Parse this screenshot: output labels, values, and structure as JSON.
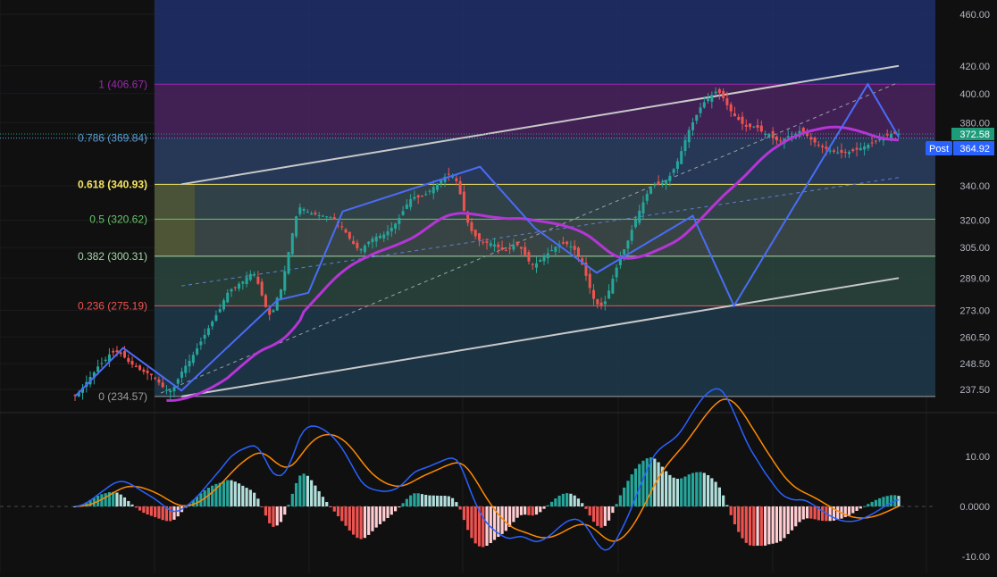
{
  "chart_data": [
    {
      "type": "candlestick",
      "title": "",
      "y_scale": "log",
      "ylim": [
        233,
        470
      ],
      "yticks": [
        "460.00",
        "420.00",
        "400.00",
        "380.00",
        "340.00",
        "320.00",
        "305.00",
        "289.00",
        "273.00",
        "260.50",
        "248.50",
        "237.50"
      ],
      "price_labels": [
        {
          "label": "",
          "value": "372.58",
          "color": "#1e9c7a"
        },
        {
          "label": "Post",
          "value": "364.92",
          "color": "#2962ff"
        }
      ],
      "fib_levels": [
        {
          "label": "1 (406.67)",
          "value": 406.67,
          "color": "#9c27b0"
        },
        {
          "label": "0.786 (369.84)",
          "value": 369.84,
          "color": "#5b9bd5"
        },
        {
          "label": "0.618 (340.93)",
          "value": 340.93,
          "color": "#f5e663"
        },
        {
          "label": "0.5 (320.62)",
          "value": 320.62,
          "color": "#67c36b"
        },
        {
          "label": "0.382 (300.31)",
          "value": 300.31,
          "color": "#a5d6a7"
        },
        {
          "label": "0.236 (275.19)",
          "value": 275.19,
          "color": "#ef5350"
        },
        {
          "label": "0 (234.57)",
          "value": 234.57,
          "color": "#9e9e9e"
        }
      ],
      "colors": {
        "up": "#26a69a",
        "down": "#ef5350",
        "zigzag": "#4a6cf7",
        "moving_average": "#b535d6",
        "channel": "#c8c8c8"
      },
      "x": [
        0,
        1,
        2,
        3,
        4,
        5,
        6,
        7,
        8,
        9,
        10,
        11,
        12,
        13,
        14,
        15,
        16,
        17,
        18,
        19,
        20,
        21,
        22,
        23,
        24,
        25,
        26,
        27,
        28,
        29,
        30,
        31,
        32,
        33,
        34,
        35,
        36,
        37,
        38,
        39,
        40,
        41,
        42,
        43,
        44,
        45,
        46,
        47,
        48,
        49,
        50,
        51,
        52,
        53,
        54,
        55,
        56,
        57,
        58,
        59,
        60,
        61,
        62,
        63,
        64,
        65,
        66,
        67,
        68,
        69,
        70,
        71,
        72,
        73,
        74,
        75,
        76,
        77,
        78,
        79,
        80,
        81,
        82,
        83,
        84,
        85,
        86,
        87,
        88,
        89,
        90,
        91,
        92,
        93,
        94,
        95,
        96,
        97,
        98,
        99,
        100,
        101,
        102,
        103,
        104,
        105,
        106,
        107,
        108,
        109,
        110,
        111,
        112,
        113,
        114,
        115,
        116,
        117,
        118,
        119,
        120,
        121,
        122,
        123,
        124,
        125,
        126,
        127,
        128,
        129,
        130,
        131,
        132,
        133,
        134,
        135,
        136,
        137,
        138,
        139,
        140,
        141,
        142,
        143,
        144,
        145,
        146,
        147,
        148,
        149,
        150,
        151,
        152,
        153,
        154,
        155,
        156,
        157,
        158,
        159,
        160,
        161,
        162,
        163,
        164,
        165,
        166,
        167,
        168,
        169,
        170,
        171,
        172,
        173,
        174,
        175,
        176,
        177,
        178,
        179,
        180,
        181,
        182,
        183,
        184,
        185,
        186,
        187,
        188,
        189,
        190,
        191,
        192,
        193,
        194,
        195,
        196,
        197,
        198,
        199,
        200,
        201,
        202,
        203,
        204,
        205,
        206,
        207,
        208,
        209,
        210,
        211,
        212,
        213,
        214,
        215,
        216,
        217,
        218,
        219
      ],
      "close": [
        235,
        236.2,
        238.2,
        240.6,
        242.8,
        244.8,
        247.3,
        248.8,
        250.3,
        252.6,
        253.5,
        253.7,
        252.8,
        251.2,
        249.3,
        248.1,
        247,
        245.8,
        245,
        244.4,
        243.5,
        242.2,
        240.4,
        238.5,
        237.3,
        237,
        238.5,
        241.8,
        245.1,
        247.6,
        249.8,
        252.4,
        255.3,
        258.4,
        261.5,
        264.6,
        267.7,
        270.7,
        273.6,
        277.9,
        281.6,
        283.4,
        284.4,
        286.1,
        287.2,
        289.4,
        291.1,
        291,
        286.1,
        280.3,
        274.6,
        270.9,
        273.1,
        279.1,
        283.3,
        292.5,
        302.6,
        312.7,
        322.2,
        327.3,
        326.4,
        324.8,
        323.9,
        323.3,
        322.8,
        322.5,
        322.2,
        321.7,
        320.4,
        318.4,
        316.1,
        313.1,
        309.8,
        306.9,
        304.6,
        304.2,
        306,
        308.1,
        309.8,
        310.9,
        311.4,
        312.1,
        313.8,
        315.8,
        318.1,
        321.3,
        325.2,
        329,
        332.1,
        333.4,
        333.1,
        333.6,
        335.1,
        337,
        339.4,
        341.3,
        343.3,
        345.5,
        346.8,
        346,
        342.8,
        335,
        325.3,
        318.6,
        313.9,
        311.1,
        309.1,
        307.8,
        307.5,
        307.3,
        306.6,
        305.2,
        303.7,
        303.3,
        304.2,
        306.2,
        306.2,
        304.3,
        300.9,
        297.6,
        296.1,
        296.6,
        298.4,
        300.3,
        301.9,
        303.6,
        305.4,
        306.7,
        307.1,
        306.8,
        305.6,
        303.7,
        300.5,
        295.9,
        290.1,
        284,
        278.6,
        275.9,
        275.1,
        277.4,
        282.7,
        288.6,
        294.4,
        299.6,
        304,
        308.7,
        314.6,
        320.4,
        325.4,
        330.3,
        335.2,
        339.1,
        340.8,
        340.9,
        341.7,
        343.5,
        346.1,
        350.1,
        355.1,
        361.5,
        368.6,
        375.2,
        380.2,
        385.3,
        390.3,
        394,
        396.6,
        399.1,
        401.4,
        400.4,
        396.8,
        391.9,
        387.7,
        384.3,
        381.9,
        379.2,
        377.3,
        377.1,
        377.5,
        376.6,
        374.2,
        372.6,
        372.6,
        369.9,
        368.4,
        368,
        369.4,
        371,
        371.3,
        372.6,
        374.5,
        373.4,
        371.3,
        368.9,
        367,
        364.9,
        363.9,
        362.8,
        361.8,
        361,
        360.6,
        360.4,
        360.6,
        360.9,
        361.5,
        362.4,
        363.4,
        364.5,
        365.6,
        366.8,
        368.1,
        369.4,
        370.5,
        371.6,
        372.6,
        372.8,
        372.6
      ],
      "zigzag": [
        [
          0,
          234.6
        ],
        [
          14,
          255.5
        ],
        [
          31,
          237
        ],
        [
          59,
          278
        ],
        [
          68,
          281.6
        ],
        [
          78,
          325
        ],
        [
          118,
          351.6
        ],
        [
          134,
          315.6
        ],
        [
          152,
          291.7
        ],
        [
          180,
          322.5
        ],
        [
          192,
          275.2
        ],
        [
          231,
          406.7
        ],
        [
          240,
          370.5
        ]
      ],
      "channel_upper": [
        [
          31,
          340.93
        ],
        [
          240,
          420
        ]
      ],
      "channel_lower": [
        [
          31,
          234.57
        ],
        [
          240,
          289
        ]
      ],
      "series": [
        {
          "name": "",
          "values": "moving_average"
        },
        {
          "name": "",
          "values": "macd"
        }
      ]
    },
    {
      "type": "bar",
      "title": "",
      "ylim": [
        -12,
        14
      ],
      "yticks": [
        "10.00",
        "0.0000",
        "-10.00"
      ]
    }
  ]
}
